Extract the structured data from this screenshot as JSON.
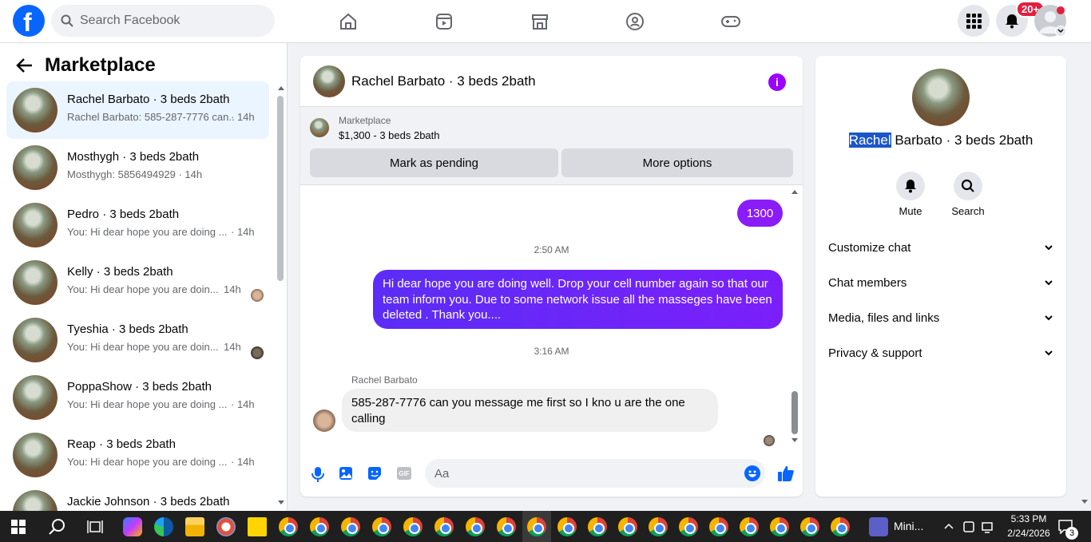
{
  "header": {
    "search_placeholder": "Search Facebook",
    "notification_badge": "20+"
  },
  "sidebar": {
    "title": "Marketplace",
    "conversations": [
      {
        "name": "Rachel Barbato · 3 beds 2bath",
        "preview": "Rachel Barbato: 585-287-7776 can...",
        "time": "· 14h",
        "active": true
      },
      {
        "name": "Mosthygh · 3 beds 2bath",
        "preview": "Mosthygh: 5856494929 · 14h",
        "time": ""
      },
      {
        "name": "Pedro · 3 beds 2bath",
        "preview": "You: Hi dear hope you are doing ...",
        "time": "· 14h"
      },
      {
        "name": "Kelly · 3 beds 2bath",
        "preview": "You: Hi dear hope you are doin...",
        "time": "14h"
      },
      {
        "name": "Tyeshia · 3 beds 2bath",
        "preview": "You: Hi dear hope you are doin...",
        "time": "14h"
      },
      {
        "name": "PoppaShow · 3 beds 2bath",
        "preview": "You: Hi dear hope you are doing ...",
        "time": "· 14h"
      },
      {
        "name": "Reap · 3 beds 2bath",
        "preview": "You: Hi dear hope you are doing ...",
        "time": "· 14h"
      },
      {
        "name": "Jackie Johnson · 3 beds 2bath",
        "preview": "",
        "time": ""
      }
    ]
  },
  "chat": {
    "title": "Rachel Barbato · 3 beds 2bath",
    "listing_label": "Marketplace",
    "listing_price": "$1,300 - 3 beds 2bath",
    "mark_pending": "Mark as pending",
    "more_options": "More options",
    "msg_1300": "1300",
    "time_1": "2:50 AM",
    "msg_long": "Hi dear hope you are doing well.  Drop your cell number again so that our team  inform you.  Due to some network issue all the masseges have been deleted . Thank you....",
    "time_2": "3:16 AM",
    "sender": "Rachel Barbato",
    "msg_reply": "585-287-7776 can you message me first so I kno u are the one calling",
    "composer_placeholder": "Aa"
  },
  "details": {
    "name_first": "Rachel",
    "name_rest": " Barbato · 3 beds 2bath",
    "mute": "Mute",
    "search": "Search",
    "sections": [
      "Customize chat",
      "Chat members",
      "Media, files and links",
      "Privacy & support"
    ]
  },
  "taskbar": {
    "app_label": "Mini...",
    "time": "5:33 PM",
    "date": "2/24/2026",
    "notif_count": "3"
  },
  "colors": {
    "brand": "#0866ff",
    "my_bubble": "#7b1ffa",
    "info": "#9b00ff"
  }
}
